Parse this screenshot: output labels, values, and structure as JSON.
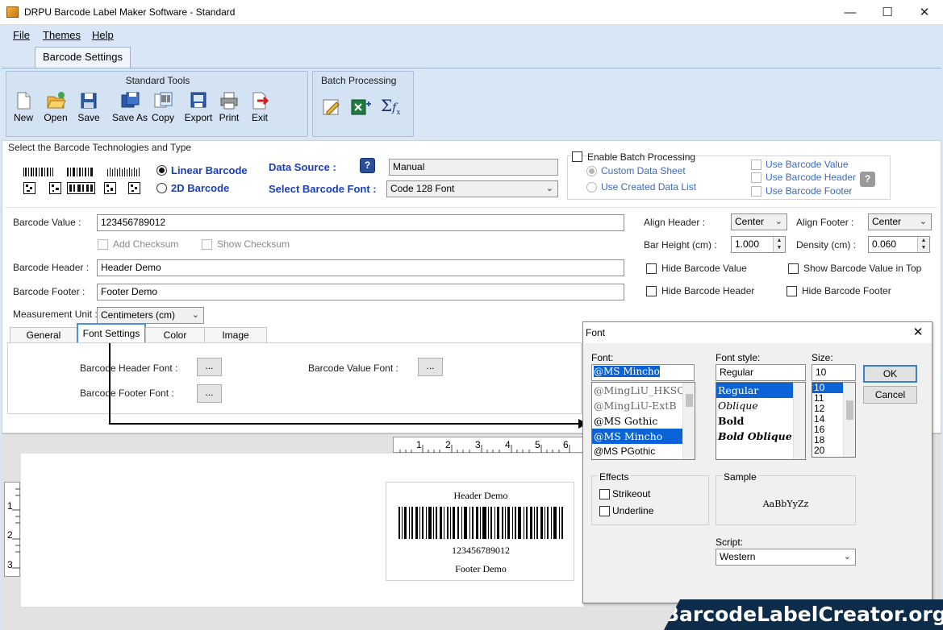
{
  "window": {
    "title": "DRPU Barcode Label Maker Software - Standard",
    "minimize": "—",
    "maximize": "☐",
    "close": "✕"
  },
  "menu": {
    "file": "File",
    "themes": "Themes",
    "help": "Help"
  },
  "ribbon": {
    "tab": "Barcode Settings",
    "standard_tools_title": "Standard Tools",
    "batch_title": "Batch Processing",
    "tools": [
      "New",
      "Open",
      "Save",
      "Save As",
      "Copy",
      "Export",
      "Print",
      "Exit"
    ]
  },
  "tech": {
    "section_label": "Select the Barcode Technologies and Type",
    "linear": "Linear Barcode",
    "twod": "2D Barcode",
    "data_source_label": "Data Source :",
    "data_source_value": "Manual",
    "font_label": "Select Barcode Font :",
    "font_value": "Code 128 Font",
    "help_icon": "?"
  },
  "batch": {
    "enable": "Enable Batch Processing",
    "custom": "Custom Data Sheet",
    "created": "Use Created Data List",
    "use_value": "Use Barcode Value",
    "use_header": "Use Barcode Header",
    "use_footer": "Use Barcode Footer",
    "help_icon": "?"
  },
  "form": {
    "value_label": "Barcode Value :",
    "value": "123456789012",
    "add_checksum": "Add Checksum",
    "show_checksum": "Show Checksum",
    "header_label": "Barcode Header :",
    "header": "Header Demo",
    "footer_label": "Barcode Footer :",
    "footer": "Footer Demo",
    "unit_label": "Measurement Unit :",
    "unit": "Centimeters (cm)"
  },
  "right_opts": {
    "align_header_label": "Align Header :",
    "align_header": "Center",
    "align_footer_label": "Align Footer :",
    "align_footer": "Center",
    "bar_height_label": "Bar Height (cm) :",
    "bar_height": "1.000",
    "density_label": "Density (cm) :",
    "density": "0.060",
    "hide_value": "Hide Barcode Value",
    "show_value_top": "Show Barcode Value in Top",
    "hide_header": "Hide Barcode Header",
    "hide_footer": "Hide Barcode Footer"
  },
  "subtabs": [
    "General Settings",
    "Font Settings",
    "Color Settings",
    "Image Settings"
  ],
  "font_settings": {
    "header_font": "Barcode Header Font :",
    "footer_font": "Barcode Footer Font :",
    "value_font": "Barcode Value Font :",
    "btn": "..."
  },
  "rulers": {
    "h": [
      "1",
      "2",
      "3",
      "4",
      "5",
      "6"
    ],
    "v": [
      "1",
      "2",
      "3"
    ]
  },
  "label_preview": {
    "header": "Header Demo",
    "value": "123456789012",
    "footer": "Footer Demo"
  },
  "font_dialog": {
    "title": "Font",
    "font_label": "Font:",
    "font_value": "@MS Mincho",
    "fonts": [
      "@MingLiU_HKSCS-ExtB",
      "@MingLiU-ExtB",
      "@MS Gothic",
      "@MS Mincho",
      "@MS PGothic"
    ],
    "style_label": "Font style:",
    "style_value": "Regular",
    "styles": [
      "Regular",
      "Oblique",
      "Bold",
      "Bold Oblique"
    ],
    "size_label": "Size:",
    "size_value": "10",
    "sizes": [
      "10",
      "11",
      "12",
      "14",
      "16",
      "18",
      "20"
    ],
    "ok": "OK",
    "cancel": "Cancel",
    "effects": "Effects",
    "strikeout": "Strikeout",
    "underline": "Underline",
    "sample_label": "Sample",
    "sample_text": "AaBbYyZz",
    "script_label": "Script:",
    "script_value": "Western"
  },
  "watermark": "BarcodeLabelCreator.org",
  "colors": {
    "accent": "#1a3fb8",
    "selection": "#0a64d8",
    "watermark_bg": "#0d2c49"
  }
}
